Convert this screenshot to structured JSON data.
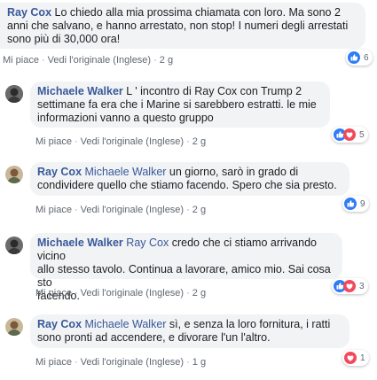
{
  "colors": {
    "link": "#385898",
    "meta": "#606770",
    "bubble": "#f2f3f5",
    "like": "#2e7cf6",
    "love": "#f2495d"
  },
  "actions": {
    "like": "Mi piace",
    "see_original": "Vedi l'originale (Inglese)",
    "dot": "·"
  },
  "comments": [
    {
      "author": "Ray Cox",
      "mention": "",
      "text_lines": [
        " Lo chiedo alla mia prossima chiamata con loro. Ma sono 2",
        "anni che salvano, e hanno arrestato, non stop! I numeri degli arrestati",
        "sono più di 30,000 ora!"
      ],
      "time": "2 g",
      "reactions": [
        "like"
      ],
      "reaction_count": "6"
    },
    {
      "author": "Michaele Walker",
      "mention": "",
      "text_lines": [
        " L ' incontro di Ray Cox con Trump 2",
        "settimane fa era che i Marine si sarebbero estratti. le mie",
        "informazioni vanno a questo gruppo"
      ],
      "time": "2 g",
      "reactions": [
        "like",
        "love"
      ],
      "reaction_count": "5"
    },
    {
      "author": "Ray Cox",
      "mention": "Michaele Walker",
      "text_lines": [
        " un giorno, sarò in grado di",
        "condividere quello che stiamo facendo. Spero che sia presto."
      ],
      "time": "2 g",
      "reactions": [
        "like"
      ],
      "reaction_count": "9"
    },
    {
      "author": "Michaele Walker",
      "mention": "Ray Cox",
      "text_lines": [
        " credo che ci stiamo arrivando vicino",
        "allo stesso tavolo. Continua a lavorare, amico mio. Sai cosa sto",
        "facendo."
      ],
      "time": "2 g",
      "reactions": [
        "like",
        "love"
      ],
      "reaction_count": "3"
    },
    {
      "author": "Ray Cox",
      "mention": "Michaele Walker",
      "text_lines": [
        " sì, e senza la loro fornitura, i ratti",
        "sono pronti ad accendere, e divorare l'un l'altro."
      ],
      "time": "1 g",
      "reactions": [
        "love"
      ],
      "reaction_count": "1"
    }
  ]
}
